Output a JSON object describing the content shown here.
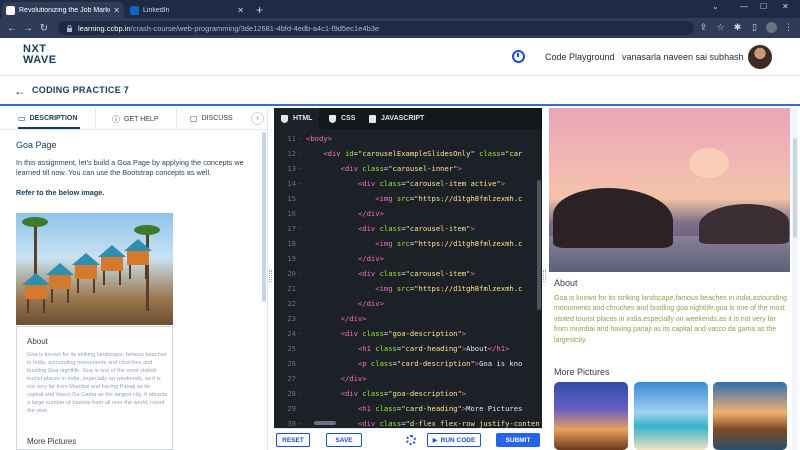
{
  "browser": {
    "tabs": [
      {
        "title": "Revolutionizing the Job Market |",
        "favicon_color": "#ffffff"
      },
      {
        "title": "LinkedIn",
        "favicon_color": "#0a66c2"
      }
    ],
    "url_host": "learning.ccbp.in",
    "url_path": "/crash-course/web-programming/3de12681-4bfd-4edb-a4c1-f9d5ec1e4b3e"
  },
  "header": {
    "logo_line1": "NXT",
    "logo_line2": "WAVE",
    "playground_link": "Code Playground",
    "user_name": "vanasarla naveen sai subhash"
  },
  "title_row": {
    "title": "CODING PRACTICE 7"
  },
  "left_panel": {
    "tabs": [
      {
        "label": "DESCRIPTION",
        "active": true
      },
      {
        "label": "GET HELP",
        "active": false
      },
      {
        "label": "DISCUSS",
        "active": false
      }
    ],
    "heading": "Goa Page",
    "intro": "In this assignment, let's build a Goa Page by applying the concepts we learned till now. You can use the Bootstrap concepts as well.",
    "refer": "Refer to the below image.",
    "preview": {
      "about_heading": "About",
      "about_text": "Goa is known for its striking landscape, famous beaches in India, astounding monuments and churches and bustling Goa nightlife. Goa is one of the most visited tourist places in India, especially on weekends, as it is not very far from Mumbai and having Panaji as its capital and Vasco Da Gama as the largest city. It attracts a large number of tourists from all over the world, round the year.",
      "more_heading": "More Pictures"
    }
  },
  "editor": {
    "tabs": [
      {
        "label": "HTML",
        "active": true
      },
      {
        "label": "CSS",
        "active": false
      },
      {
        "label": "JAVASCRIPT",
        "active": false
      }
    ],
    "lines": [
      {
        "n": "11",
        "fold": "-",
        "indent": "",
        "segs": [
          [
            "tg",
            "<body>"
          ]
        ]
      },
      {
        "n": "12",
        "fold": "-",
        "indent": "  ",
        "segs": [
          [
            "tg",
            "<div "
          ],
          [
            "at",
            "id"
          ],
          [
            "pl",
            "="
          ],
          [
            "st",
            "\"carouselExampleSlidesOnly\""
          ],
          [
            "pl",
            " "
          ],
          [
            "at",
            "class"
          ],
          [
            "pl",
            "="
          ],
          [
            "st",
            "\"car"
          ]
        ]
      },
      {
        "n": "13",
        "fold": "-",
        "indent": "    ",
        "segs": [
          [
            "tg",
            "<div "
          ],
          [
            "at",
            "class"
          ],
          [
            "pl",
            "="
          ],
          [
            "st",
            "\"carousel-inner\""
          ],
          [
            "tg",
            ">"
          ]
        ]
      },
      {
        "n": "14",
        "fold": "-",
        "indent": "      ",
        "segs": [
          [
            "tg",
            "<div "
          ],
          [
            "at",
            "class"
          ],
          [
            "pl",
            "="
          ],
          [
            "st",
            "\"carousel-item active\""
          ],
          [
            "tg",
            ">"
          ]
        ]
      },
      {
        "n": "15",
        "fold": "",
        "indent": "        ",
        "segs": [
          [
            "tg",
            "<img "
          ],
          [
            "at",
            "src"
          ],
          [
            "pl",
            "="
          ],
          [
            "st",
            "\"https://d1tgh8fmlzexmh.c"
          ]
        ]
      },
      {
        "n": "16",
        "fold": "",
        "indent": "      ",
        "segs": [
          [
            "tg",
            "</div>"
          ]
        ]
      },
      {
        "n": "17",
        "fold": "-",
        "indent": "      ",
        "segs": [
          [
            "tg",
            "<div "
          ],
          [
            "at",
            "class"
          ],
          [
            "pl",
            "="
          ],
          [
            "st",
            "\"carousel-item\""
          ],
          [
            "tg",
            ">"
          ]
        ]
      },
      {
        "n": "18",
        "fold": "",
        "indent": "        ",
        "segs": [
          [
            "tg",
            "<img "
          ],
          [
            "at",
            "src"
          ],
          [
            "pl",
            "="
          ],
          [
            "st",
            "\"https://d1tgh8fmlzexmh.c"
          ]
        ]
      },
      {
        "n": "19",
        "fold": "",
        "indent": "      ",
        "segs": [
          [
            "tg",
            "</div>"
          ]
        ]
      },
      {
        "n": "20",
        "fold": "-",
        "indent": "      ",
        "segs": [
          [
            "tg",
            "<div "
          ],
          [
            "at",
            "class"
          ],
          [
            "pl",
            "="
          ],
          [
            "st",
            "\"carousel-item\""
          ],
          [
            "tg",
            ">"
          ]
        ]
      },
      {
        "n": "21",
        "fold": "",
        "indent": "        ",
        "segs": [
          [
            "tg",
            "<img "
          ],
          [
            "at",
            "src"
          ],
          [
            "pl",
            "="
          ],
          [
            "st",
            "\"https://d1tgh8fmlzexmh.c"
          ]
        ]
      },
      {
        "n": "22",
        "fold": "",
        "indent": "      ",
        "segs": [
          [
            "tg",
            "</div>"
          ]
        ]
      },
      {
        "n": "23",
        "fold": "",
        "indent": "    ",
        "segs": [
          [
            "tg",
            "</div>"
          ]
        ]
      },
      {
        "n": "24",
        "fold": "-",
        "indent": "    ",
        "segs": [
          [
            "tg",
            "<div "
          ],
          [
            "at",
            "class"
          ],
          [
            "pl",
            "="
          ],
          [
            "st",
            "\"goa-description\""
          ],
          [
            "tg",
            ">"
          ]
        ]
      },
      {
        "n": "25",
        "fold": "",
        "indent": "      ",
        "segs": [
          [
            "tg",
            "<h1 "
          ],
          [
            "at",
            "class"
          ],
          [
            "pl",
            "="
          ],
          [
            "st",
            "\"card-heading\""
          ],
          [
            "tg",
            ">"
          ],
          [
            "pl",
            "About"
          ],
          [
            "tg",
            "</h1>"
          ]
        ]
      },
      {
        "n": "26",
        "fold": "",
        "indent": "      ",
        "segs": [
          [
            "tg",
            "<p "
          ],
          [
            "at",
            "class"
          ],
          [
            "pl",
            "="
          ],
          [
            "st",
            "\"card-description\""
          ],
          [
            "tg",
            ">"
          ],
          [
            "pl",
            "Goa is kno"
          ]
        ]
      },
      {
        "n": "27",
        "fold": "",
        "indent": "    ",
        "segs": [
          [
            "tg",
            "</div>"
          ]
        ]
      },
      {
        "n": "28",
        "fold": "-",
        "indent": "    ",
        "segs": [
          [
            "tg",
            "<div "
          ],
          [
            "at",
            "class"
          ],
          [
            "pl",
            "="
          ],
          [
            "st",
            "\"goa-description\""
          ],
          [
            "tg",
            ">"
          ]
        ]
      },
      {
        "n": "29",
        "fold": "",
        "indent": "      ",
        "segs": [
          [
            "tg",
            "<h1 "
          ],
          [
            "at",
            "class"
          ],
          [
            "pl",
            "="
          ],
          [
            "st",
            "\"card-heading\""
          ],
          [
            "tg",
            ">"
          ],
          [
            "pl",
            "More Pictures"
          ]
        ]
      },
      {
        "n": "30",
        "fold": "-",
        "indent": "      ",
        "segs": [
          [
            "tg",
            "<div "
          ],
          [
            "at",
            "class"
          ],
          [
            "pl",
            "="
          ],
          [
            "st",
            "\"d-flex flex-row justify-conten"
          ]
        ]
      }
    ],
    "buttons": {
      "reset": "RESET",
      "save": "SAVE",
      "run_code": "RUN CODE",
      "submit": "SUBMIT"
    }
  },
  "output": {
    "about_heading": "About",
    "about_text": "Goa is known for its striking landscape,famous beaches in india,astounding monuments and chruches and bustling goa nightlife.goa is one of the most visited tourist places in india,especially on weekends,as it is not very far from mumbai and having panaji as its capital and vasco da gama as the largestcity.",
    "more_heading": "More Pictures"
  },
  "colors": {
    "brand_blue": "#1f4fd1",
    "accent_blue": "#2563eb",
    "navy": "#183b56",
    "editor_bg": "#1c2027"
  }
}
